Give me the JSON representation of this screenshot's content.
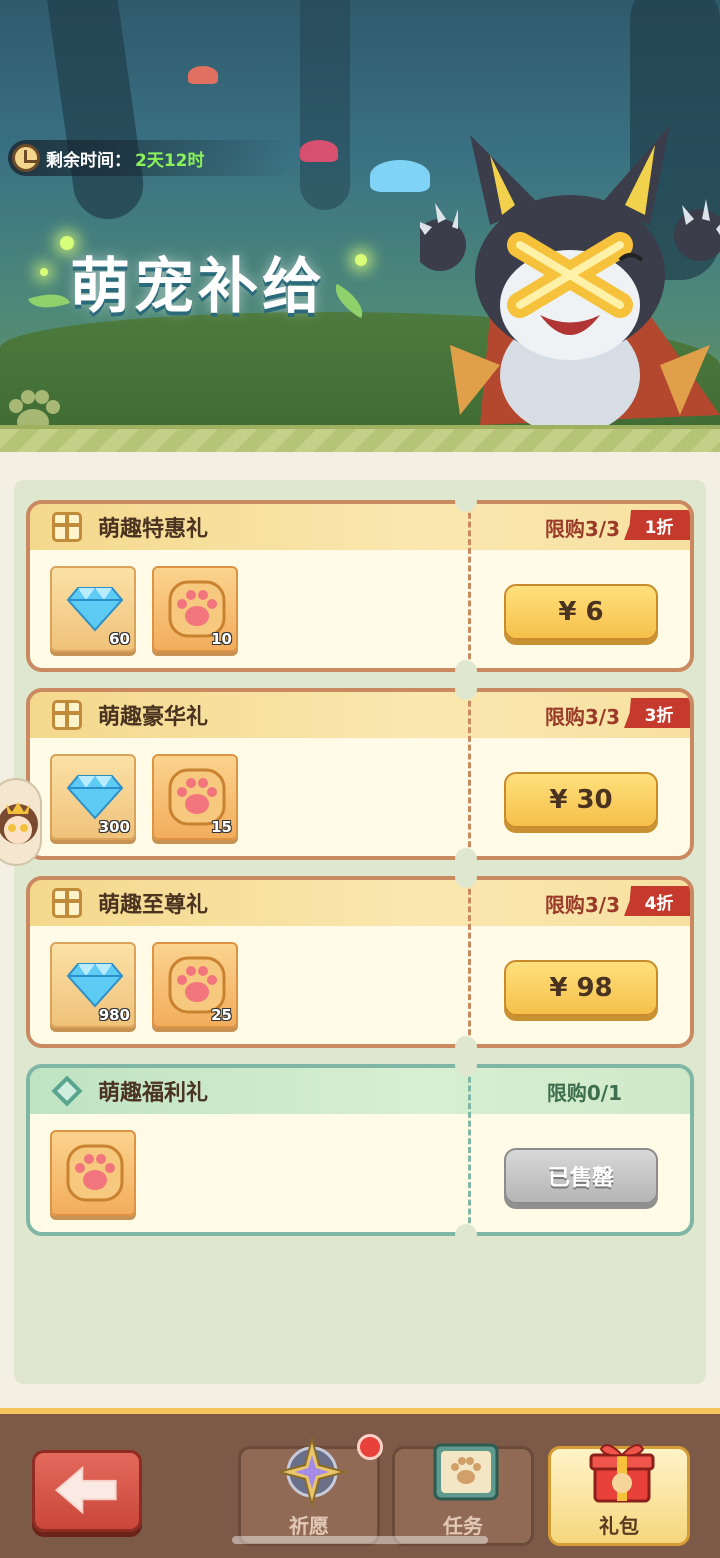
{
  "banner": {
    "timer_label": "剩余时间：",
    "timer_value": "2天12时",
    "title": "萌宠补给"
  },
  "packs": [
    {
      "title": "萌趣特惠礼",
      "limit": "限购3/3",
      "discount": "1折",
      "price": "¥ 6",
      "items": [
        {
          "icon": "diamond-icon",
          "qty": "60"
        },
        {
          "icon": "paw-icon",
          "qty": "10"
        }
      ]
    },
    {
      "title": "萌趣豪华礼",
      "limit": "限购3/3",
      "discount": "3折",
      "price": "¥ 30",
      "items": [
        {
          "icon": "diamond-icon",
          "qty": "300"
        },
        {
          "icon": "paw-icon",
          "qty": "15"
        }
      ]
    },
    {
      "title": "萌趣至尊礼",
      "limit": "限购3/3",
      "discount": "4折",
      "price": "¥ 98",
      "items": [
        {
          "icon": "diamond-icon",
          "qty": "980"
        },
        {
          "icon": "paw-icon",
          "qty": "25"
        }
      ]
    },
    {
      "title": "萌趣福利礼",
      "limit": "限购0/1",
      "status": "已售罄",
      "items": [
        {
          "icon": "paw-icon",
          "qty": ""
        }
      ]
    }
  ],
  "nav": {
    "tabs": [
      {
        "label": "祈愿",
        "icon": "compass-star-icon",
        "badge": true
      },
      {
        "label": "任务",
        "icon": "task-book-icon"
      },
      {
        "label": "礼包",
        "icon": "gift-box-icon",
        "active": true
      }
    ]
  },
  "colors": {
    "accent_gold": "#f5c04b",
    "discount_red": "#c53a2c",
    "timer_green": "#8df25a",
    "free_green": "#7fb6a6"
  }
}
